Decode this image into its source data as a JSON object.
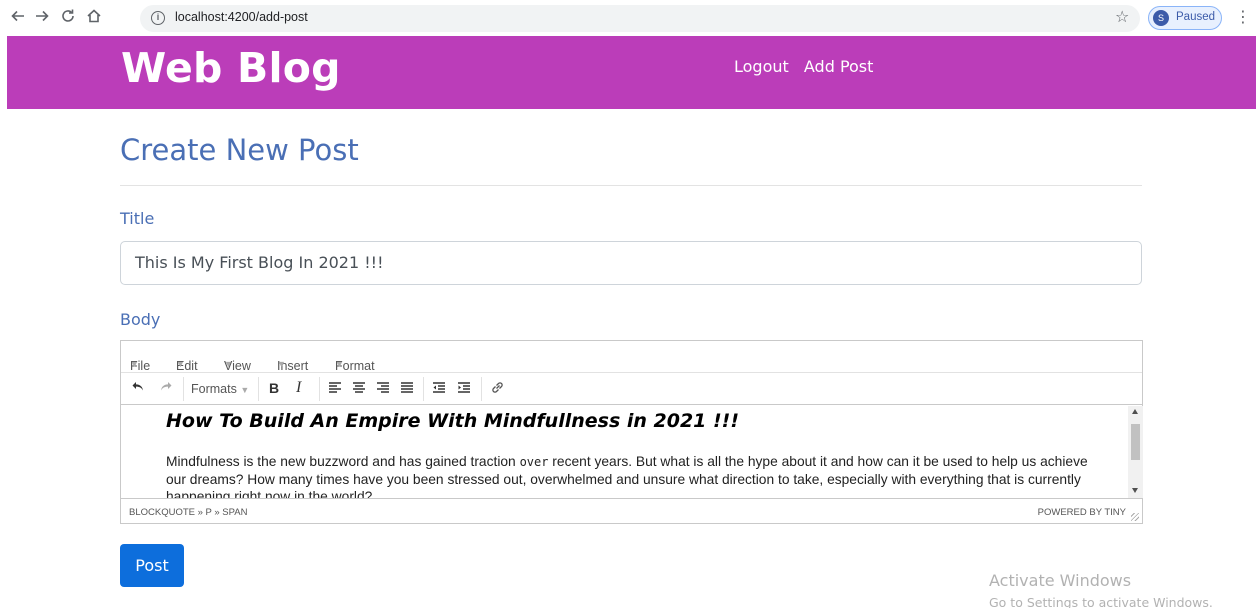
{
  "browser": {
    "url": "localhost:4200/add-post",
    "profile_initial": "S",
    "profile_status": "Paused",
    "icons": {
      "back": "arrow-left-icon",
      "forward": "arrow-right-icon",
      "reload": "reload-icon",
      "home": "home-icon",
      "info": "info-icon",
      "star": "star-icon",
      "menu": "kebab-menu-icon"
    }
  },
  "navbar": {
    "brand": "Web Blog",
    "links": [
      "Logout",
      "Add Post"
    ],
    "background_color": "#bb3db9"
  },
  "page": {
    "heading": "Create New Post",
    "title_label": "Title",
    "title_value": "This Is My First Blog In 2021 !!!",
    "body_label": "Body"
  },
  "editor": {
    "menus": [
      "File",
      "Edit",
      "View",
      "Insert",
      "Format"
    ],
    "formats_label": "Formats",
    "bold_label": "B",
    "italic_label": "I",
    "toolbar_icons": [
      "undo-icon",
      "redo-icon",
      "bold-icon",
      "italic-icon",
      "align-left-icon",
      "align-center-icon",
      "align-right-icon",
      "align-justify-icon",
      "outdent-icon",
      "indent-icon",
      "link-icon"
    ],
    "content_heading": "How To Build An Empire With Mindfullness in 2021 !!!",
    "content_paragraph_part1": "Mindfulness is the new buzzword and has gained traction ",
    "content_paragraph_code": "over",
    "content_paragraph_part2": " recent years. But what is all the hype about it and how can it be used to help us achieve our dreams? How many times have you been stressed out, overwhelmed and unsure what direction to take, especially with everything that is currently happening right now in the world?",
    "status_path": "BLOCKQUOTE » P » SPAN",
    "powered_by": "POWERED BY TINY"
  },
  "actions": {
    "post_label": "Post",
    "post_color": "#0d6edc"
  },
  "watermark": {
    "line1": "Activate Windows",
    "line2": "Go to Settings to activate Windows."
  },
  "colors": {
    "heading": "#4a6fb5"
  }
}
